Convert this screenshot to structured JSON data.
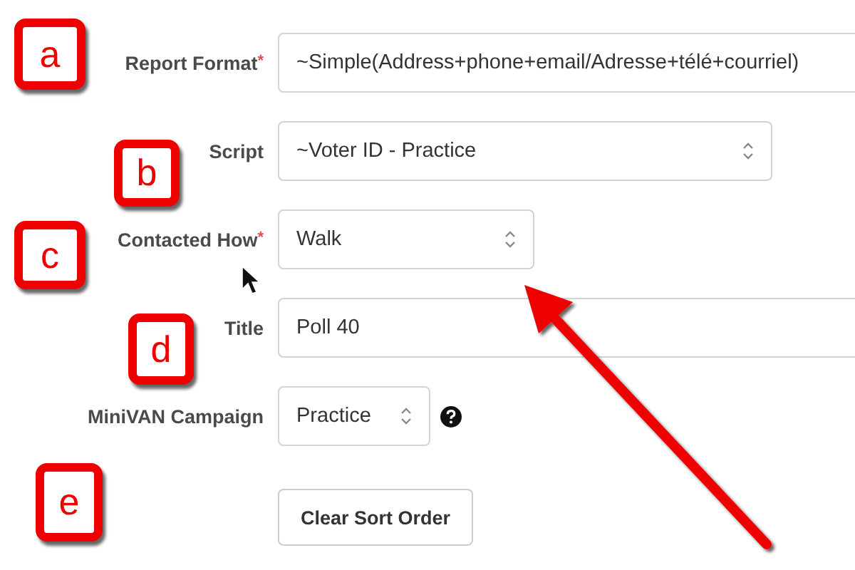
{
  "form": {
    "fields": [
      {
        "kind": "input",
        "label": "Report Format",
        "required_marker": "*",
        "value": "~Simple(Address+phone+email/Adresse+télé+courriel)"
      },
      {
        "kind": "select",
        "label": "Script",
        "value": "~Voter ID - Practice"
      },
      {
        "kind": "select",
        "label": "Contacted How",
        "required_marker": "*",
        "value": "Walk"
      },
      {
        "kind": "input",
        "label": "Title",
        "value": "Poll 40"
      },
      {
        "kind": "select",
        "label": "MiniVAN Campaign",
        "value": "Practice",
        "help": true
      }
    ],
    "button": "Clear Sort Order"
  },
  "annotations": [
    {
      "letter": "a"
    },
    {
      "letter": "b"
    },
    {
      "letter": "c"
    },
    {
      "letter": "d"
    },
    {
      "letter": "e"
    }
  ]
}
